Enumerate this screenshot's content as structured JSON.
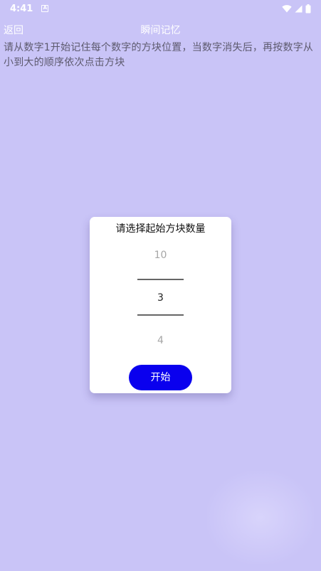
{
  "status_bar": {
    "time": "4:41",
    "notification_icon_label": "A"
  },
  "app_bar": {
    "back_label": "返回",
    "title": "瞬间记忆"
  },
  "instructions": "请从数字1开始记住每个数字的方块位置，当数字消失后，再按数字从小到大的顺序依次点击方块",
  "dialog": {
    "title": "请选择起始方块数量",
    "picker": {
      "prev": "10",
      "current": "3",
      "next": "4"
    },
    "start_label": "开始"
  },
  "colors": {
    "background": "#c9c4f7",
    "button": "#0a00ee",
    "dialog": "#ffffff"
  }
}
